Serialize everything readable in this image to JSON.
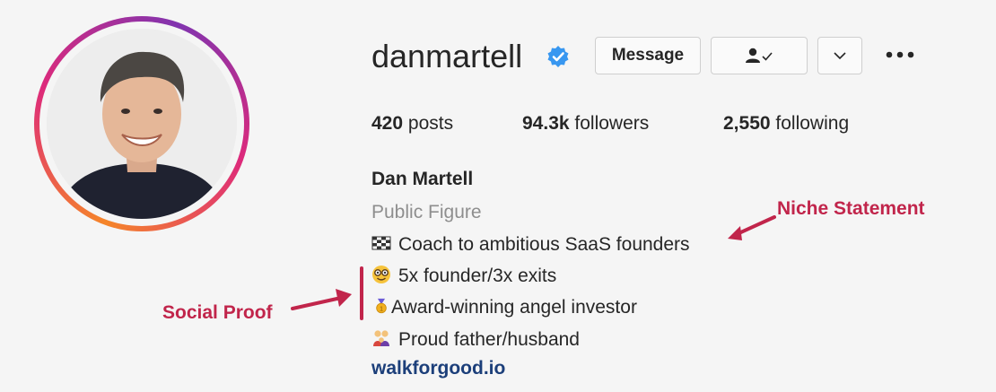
{
  "profile": {
    "username": "danmartell",
    "verified": true,
    "message_button": "Message",
    "following_icon": "person-check-icon",
    "dropdown_icon": "chevron-down-icon",
    "more_icon": "more-options-icon"
  },
  "stats": {
    "posts_count": "420",
    "posts_label": "posts",
    "followers_count": "94.3k",
    "followers_label": "followers",
    "following_count": "2,550",
    "following_label": "following"
  },
  "bio": {
    "name": "Dan Martell",
    "category": "Public Figure",
    "line1": "Coach to ambitious SaaS founders",
    "line1_icon": "checkered-flag-icon",
    "line2": "5x founder/3x exits",
    "line2_icon": "nerd-face-icon",
    "line3": "Award-winning angel investor",
    "line3_icon": "medal-icon",
    "line4": "Proud father/husband",
    "line4_icon": "family-icon",
    "website": "walkforgood.io"
  },
  "annotations": {
    "niche": "Niche Statement",
    "social_proof": "Social Proof",
    "color": "#c1254b"
  },
  "colors": {
    "verified_badge": "#3897f0",
    "link": "#1c3f7a",
    "muted": "#8e8e8e"
  }
}
